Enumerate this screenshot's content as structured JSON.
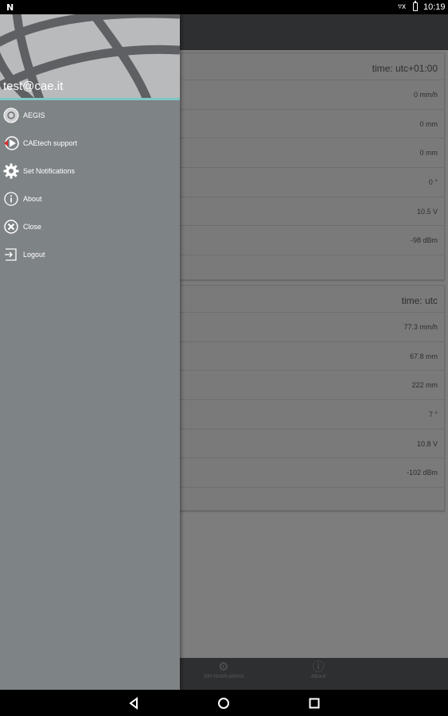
{
  "status_bar": {
    "notification_letter": "N",
    "time": "10:19"
  },
  "drawer": {
    "email": "test@cae.it",
    "items": [
      {
        "label": "AEGIS",
        "icon": "aegis-logo-icon"
      },
      {
        "label": "CAEtech support",
        "icon": "support-play-icon"
      },
      {
        "label": "Set Notifications",
        "icon": "gear-icon"
      },
      {
        "label": "About",
        "icon": "info-icon"
      },
      {
        "label": "Close",
        "icon": "close-circle-icon"
      },
      {
        "label": "Logout",
        "icon": "logout-icon"
      }
    ]
  },
  "station1": {
    "timezone": "time: utc+01:00",
    "values": [
      "0 mm/h",
      "0 mm",
      "0 mm",
      "0 °",
      "10.5 V",
      "-98 dBm"
    ]
  },
  "station2": {
    "timezone": "time: utc",
    "values": [
      "77.3 mm/h",
      "67.8 mm",
      "222 mm",
      "7 °",
      "10.8 V",
      "-102 dBm"
    ]
  },
  "bottom_nav": {
    "items": [
      {
        "label": "Set Notifications",
        "icon": "gear-icon"
      },
      {
        "label": "About",
        "icon": "info-icon"
      }
    ]
  },
  "colors": {
    "accent": "#7ec8c4",
    "toolbar": "#2e2f31",
    "drawer": "#7e8386"
  }
}
